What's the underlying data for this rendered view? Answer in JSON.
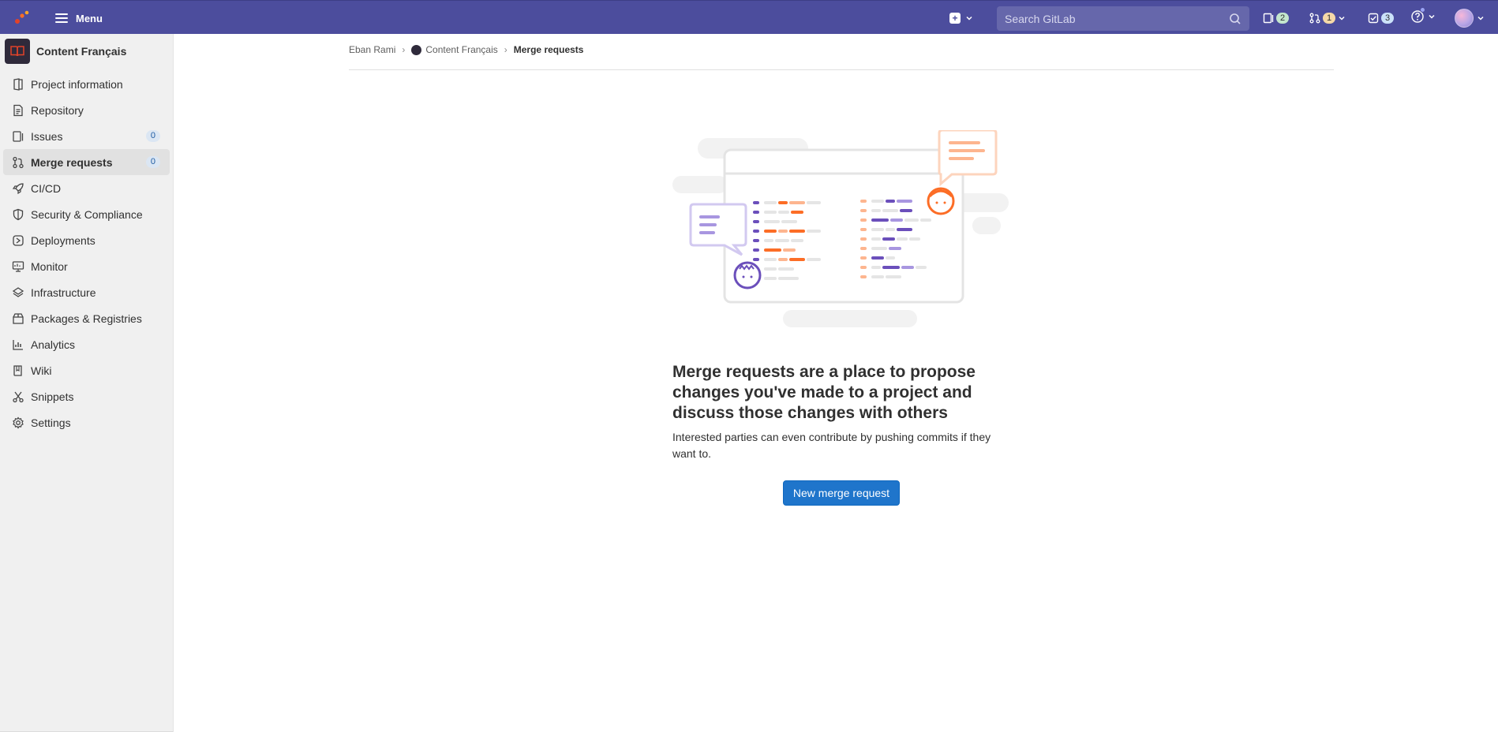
{
  "topbar": {
    "menu_label": "Menu",
    "search_placeholder": "Search GitLab",
    "issues_count": "2",
    "merge_requests_count": "1",
    "todos_count": "3"
  },
  "sidebar": {
    "project_name": "Content Français",
    "items": [
      {
        "label": "Project information",
        "icon": "project-info-icon"
      },
      {
        "label": "Repository",
        "icon": "document-icon"
      },
      {
        "label": "Issues",
        "icon": "issues-icon",
        "count": "0"
      },
      {
        "label": "Merge requests",
        "icon": "merge-request-icon",
        "count": "0",
        "active": true
      },
      {
        "label": "CI/CD",
        "icon": "rocket-icon"
      },
      {
        "label": "Security & Compliance",
        "icon": "shield-icon"
      },
      {
        "label": "Deployments",
        "icon": "deployments-icon"
      },
      {
        "label": "Monitor",
        "icon": "monitor-icon"
      },
      {
        "label": "Infrastructure",
        "icon": "cloud-icon"
      },
      {
        "label": "Packages & Registries",
        "icon": "package-icon"
      },
      {
        "label": "Analytics",
        "icon": "chart-icon"
      },
      {
        "label": "Wiki",
        "icon": "book-icon"
      },
      {
        "label": "Snippets",
        "icon": "scissors-icon"
      },
      {
        "label": "Settings",
        "icon": "gear-icon"
      }
    ]
  },
  "breadcrumb": {
    "user": "Eban Rami",
    "project": "Content Français",
    "current": "Merge requests"
  },
  "empty_state": {
    "title": "Merge requests are a place to propose changes you've made to a project and discuss those changes with others",
    "description": "Interested parties can even contribute by pushing commits if they want to.",
    "button_label": "New merge request"
  },
  "colors": {
    "navbar": "#4c4d9d",
    "accent_button": "#1f75cb",
    "illustration_orange": "#fc6d26",
    "illustration_purple": "#6b4fbb"
  }
}
